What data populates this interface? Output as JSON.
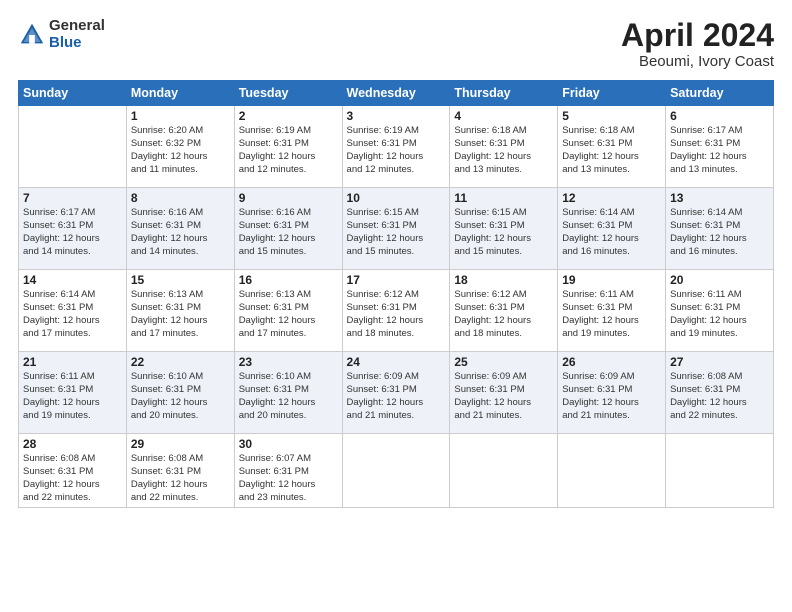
{
  "header": {
    "logo_general": "General",
    "logo_blue": "Blue",
    "month_title": "April 2024",
    "location": "Beoumi, Ivory Coast"
  },
  "weekdays": [
    "Sunday",
    "Monday",
    "Tuesday",
    "Wednesday",
    "Thursday",
    "Friday",
    "Saturday"
  ],
  "weeks": [
    [
      {
        "day": "",
        "info": ""
      },
      {
        "day": "1",
        "info": "Sunrise: 6:20 AM\nSunset: 6:32 PM\nDaylight: 12 hours\nand 11 minutes."
      },
      {
        "day": "2",
        "info": "Sunrise: 6:19 AM\nSunset: 6:31 PM\nDaylight: 12 hours\nand 12 minutes."
      },
      {
        "day": "3",
        "info": "Sunrise: 6:19 AM\nSunset: 6:31 PM\nDaylight: 12 hours\nand 12 minutes."
      },
      {
        "day": "4",
        "info": "Sunrise: 6:18 AM\nSunset: 6:31 PM\nDaylight: 12 hours\nand 13 minutes."
      },
      {
        "day": "5",
        "info": "Sunrise: 6:18 AM\nSunset: 6:31 PM\nDaylight: 12 hours\nand 13 minutes."
      },
      {
        "day": "6",
        "info": "Sunrise: 6:17 AM\nSunset: 6:31 PM\nDaylight: 12 hours\nand 13 minutes."
      }
    ],
    [
      {
        "day": "7",
        "info": "Sunrise: 6:17 AM\nSunset: 6:31 PM\nDaylight: 12 hours\nand 14 minutes."
      },
      {
        "day": "8",
        "info": "Sunrise: 6:16 AM\nSunset: 6:31 PM\nDaylight: 12 hours\nand 14 minutes."
      },
      {
        "day": "9",
        "info": "Sunrise: 6:16 AM\nSunset: 6:31 PM\nDaylight: 12 hours\nand 15 minutes."
      },
      {
        "day": "10",
        "info": "Sunrise: 6:15 AM\nSunset: 6:31 PM\nDaylight: 12 hours\nand 15 minutes."
      },
      {
        "day": "11",
        "info": "Sunrise: 6:15 AM\nSunset: 6:31 PM\nDaylight: 12 hours\nand 15 minutes."
      },
      {
        "day": "12",
        "info": "Sunrise: 6:14 AM\nSunset: 6:31 PM\nDaylight: 12 hours\nand 16 minutes."
      },
      {
        "day": "13",
        "info": "Sunrise: 6:14 AM\nSunset: 6:31 PM\nDaylight: 12 hours\nand 16 minutes."
      }
    ],
    [
      {
        "day": "14",
        "info": "Sunrise: 6:14 AM\nSunset: 6:31 PM\nDaylight: 12 hours\nand 17 minutes."
      },
      {
        "day": "15",
        "info": "Sunrise: 6:13 AM\nSunset: 6:31 PM\nDaylight: 12 hours\nand 17 minutes."
      },
      {
        "day": "16",
        "info": "Sunrise: 6:13 AM\nSunset: 6:31 PM\nDaylight: 12 hours\nand 17 minutes."
      },
      {
        "day": "17",
        "info": "Sunrise: 6:12 AM\nSunset: 6:31 PM\nDaylight: 12 hours\nand 18 minutes."
      },
      {
        "day": "18",
        "info": "Sunrise: 6:12 AM\nSunset: 6:31 PM\nDaylight: 12 hours\nand 18 minutes."
      },
      {
        "day": "19",
        "info": "Sunrise: 6:11 AM\nSunset: 6:31 PM\nDaylight: 12 hours\nand 19 minutes."
      },
      {
        "day": "20",
        "info": "Sunrise: 6:11 AM\nSunset: 6:31 PM\nDaylight: 12 hours\nand 19 minutes."
      }
    ],
    [
      {
        "day": "21",
        "info": "Sunrise: 6:11 AM\nSunset: 6:31 PM\nDaylight: 12 hours\nand 19 minutes."
      },
      {
        "day": "22",
        "info": "Sunrise: 6:10 AM\nSunset: 6:31 PM\nDaylight: 12 hours\nand 20 minutes."
      },
      {
        "day": "23",
        "info": "Sunrise: 6:10 AM\nSunset: 6:31 PM\nDaylight: 12 hours\nand 20 minutes."
      },
      {
        "day": "24",
        "info": "Sunrise: 6:09 AM\nSunset: 6:31 PM\nDaylight: 12 hours\nand 21 minutes."
      },
      {
        "day": "25",
        "info": "Sunrise: 6:09 AM\nSunset: 6:31 PM\nDaylight: 12 hours\nand 21 minutes."
      },
      {
        "day": "26",
        "info": "Sunrise: 6:09 AM\nSunset: 6:31 PM\nDaylight: 12 hours\nand 21 minutes."
      },
      {
        "day": "27",
        "info": "Sunrise: 6:08 AM\nSunset: 6:31 PM\nDaylight: 12 hours\nand 22 minutes."
      }
    ],
    [
      {
        "day": "28",
        "info": "Sunrise: 6:08 AM\nSunset: 6:31 PM\nDaylight: 12 hours\nand 22 minutes."
      },
      {
        "day": "29",
        "info": "Sunrise: 6:08 AM\nSunset: 6:31 PM\nDaylight: 12 hours\nand 22 minutes."
      },
      {
        "day": "30",
        "info": "Sunrise: 6:07 AM\nSunset: 6:31 PM\nDaylight: 12 hours\nand 23 minutes."
      },
      {
        "day": "",
        "info": ""
      },
      {
        "day": "",
        "info": ""
      },
      {
        "day": "",
        "info": ""
      },
      {
        "day": "",
        "info": ""
      }
    ]
  ]
}
